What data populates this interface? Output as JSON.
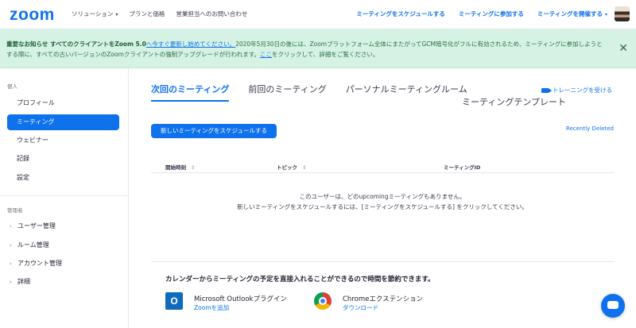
{
  "brand": {
    "logo": "zoom",
    "accent": "#0e72ed"
  },
  "topnav": {
    "left": [
      {
        "label": "ソリューション",
        "dropdown": true
      },
      {
        "label": "プランと価格",
        "dropdown": false
      },
      {
        "label": "営業担当へのお問い合わせ",
        "dropdown": false
      }
    ],
    "right": [
      {
        "label": "ミーティングをスケジュールする",
        "dropdown": false
      },
      {
        "label": "ミーティングに参加する",
        "dropdown": false
      },
      {
        "label": "ミーティングを開催する",
        "dropdown": true
      }
    ],
    "caret": "▾"
  },
  "banner": {
    "bold": "重要なお知らせ すべてのクライアントをZoom 5.0",
    "link1": "へ今すぐ更新し始めてください。",
    "mid": "2020年5月30日の後には、Zoomプラットフォーム全体にまたがってGCM暗号化がフルに有効されるため、ミーティングに参加しようとする際に、すべての古いバージョンのZoomクライアントの強制アップグレードが行われます。",
    "link2": "ここ",
    "tail": "をクリックして、詳細をご覧ください。",
    "close": "✕"
  },
  "sidebar": {
    "personal_label": "個人",
    "personal_items": [
      "プロフィール",
      "ミーティング",
      "ウェビナー",
      "記録",
      "設定"
    ],
    "admin_label": "管理者",
    "admin_items": [
      "ユーザー管理",
      "ルーム管理",
      "アカウント管理",
      "詳細"
    ],
    "chevron": "›"
  },
  "main": {
    "tabs": [
      "次回のミーティング",
      "前回のミーティング",
      "パーソナルミーティングルーム"
    ],
    "tab_row2": "ミーティングテンプレート",
    "training": "トレーニングを受ける",
    "schedule_button": "新しいミーティングをスケジュールする",
    "recently_deleted": "Recently Deleted",
    "table_headers": [
      "開始時刻",
      "トピック",
      "ミーティングID"
    ],
    "sort_icon": "⇕",
    "empty_line1": "このユーザーは、どのupcomingミーティングもありません。",
    "empty_line2": "新しいミーティングをスケジュールするには、[ミーティングをスケジュールする] をクリックしてください。",
    "calendar_title": "カレンダーからミーティングの予定を直接入れることができるので時間を節約できます。",
    "integrations": [
      {
        "icon": "outlook-icon",
        "icon_glyph": "O",
        "name": "Microsoft Outlookプラグイン",
        "link": "Zoomを追加"
      },
      {
        "icon": "chrome-icon",
        "name": "Chromeエクステンション",
        "link": "ダウンロード"
      }
    ]
  }
}
